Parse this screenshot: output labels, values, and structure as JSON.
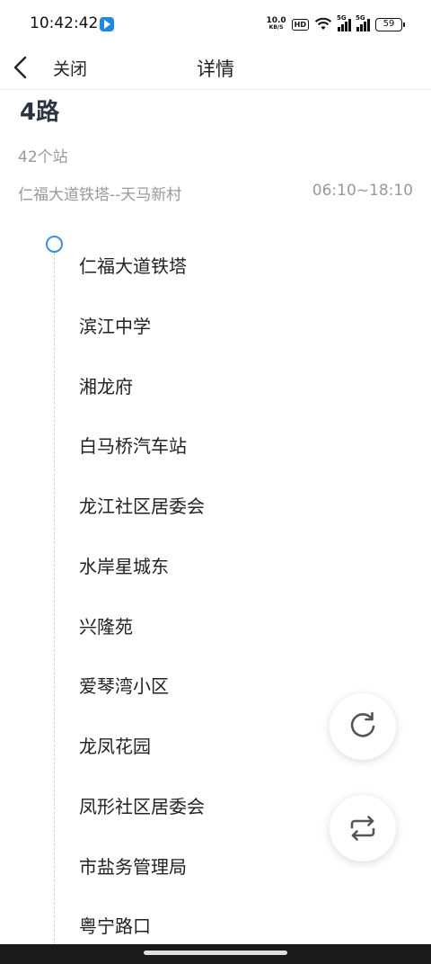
{
  "status_bar": {
    "time": "10:42:42",
    "net_speed": "10.0",
    "net_unit": "KB/S",
    "hd_label": "HD",
    "signal1_label": "5G",
    "signal2_label": "5G",
    "battery": "59"
  },
  "nav": {
    "back_icon": "chevron-left-icon",
    "close_label": "关闭",
    "title": "详情"
  },
  "route": {
    "name": "4路",
    "stop_count": "42个站",
    "direction": "仁福大道铁塔--天马新村",
    "hours": "06:10~18:10"
  },
  "stops": [
    "仁福大道铁塔",
    "滨江中学",
    "湘龙府",
    "白马桥汽车站",
    "龙江社区居委会",
    "水岸星城东",
    "兴隆苑",
    "爱琴湾小区",
    "龙凤花园",
    "凤形社区居委会",
    "市盐务管理局",
    "粤宁路口"
  ],
  "actions": {
    "refresh_icon": "refresh-icon",
    "reverse_icon": "swap-direction-icon"
  },
  "colors": {
    "accent": "#3a8ee6",
    "muted_text": "#999999",
    "title_text": "#2b3440"
  }
}
